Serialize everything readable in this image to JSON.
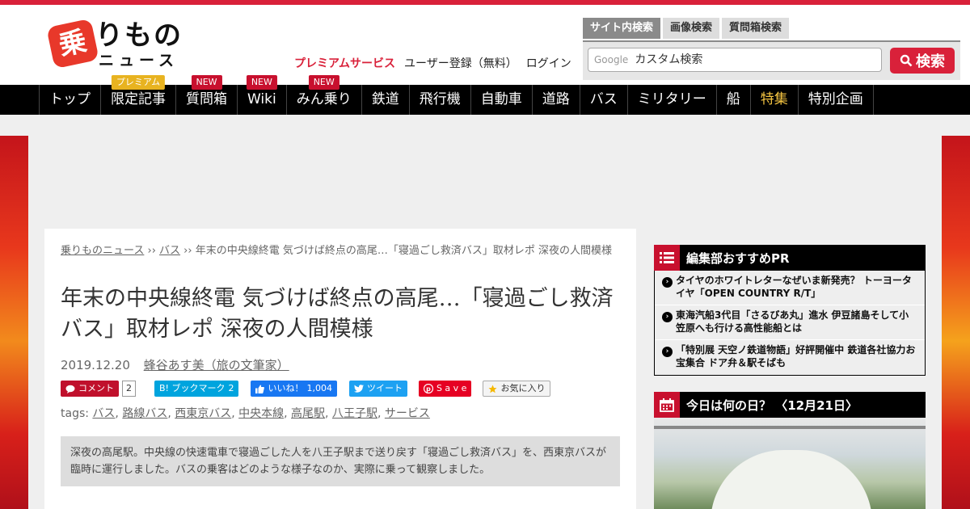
{
  "logo": {
    "mark": "乗",
    "text1": "りもの",
    "text2": "ニュース"
  },
  "header_links": {
    "premium": "プレミアムサービス",
    "register": "ユーザー登録（無料）",
    "login": "ログイン"
  },
  "search": {
    "tabs": [
      "サイト内検索",
      "画像検索",
      "質問箱検索"
    ],
    "google_label": "Google",
    "placeholder": "カスタム検索",
    "button": "検索"
  },
  "nav": [
    {
      "label": "トップ",
      "badge": ""
    },
    {
      "label": "限定記事",
      "badge": "プレミアム"
    },
    {
      "label": "質問箱",
      "badge": "NEW"
    },
    {
      "label": "Wiki",
      "badge": "NEW"
    },
    {
      "label": "みん乗り",
      "badge": "NEW"
    },
    {
      "label": "鉄道",
      "badge": ""
    },
    {
      "label": "飛行機",
      "badge": ""
    },
    {
      "label": "自動車",
      "badge": ""
    },
    {
      "label": "道路",
      "badge": ""
    },
    {
      "label": "バス",
      "badge": ""
    },
    {
      "label": "ミリタリー",
      "badge": ""
    },
    {
      "label": "船",
      "badge": ""
    },
    {
      "label": "特集",
      "badge": ""
    },
    {
      "label": "特別企画",
      "badge": ""
    }
  ],
  "breadcrumb": {
    "home": "乗りものニュース",
    "sep": " ›› ",
    "category": "バス",
    "current": "年末の中央線終電 気づけば終点の高尾…「寝過ごし救済バス」取材レポ 深夜の人間模様"
  },
  "article": {
    "title": "年末の中央線終電 気づけば終点の高尾…「寝過ごし救済バス」取材レポ 深夜の人間模様",
    "date": "2019.12.20",
    "author": "蜂谷あす美（旅の文筆家）",
    "lead": "深夜の高尾駅。中央線の快速電車で寝過ごした人を八王子駅まで送り戻す「寝過ごし救済バス」を、西東京バスが臨時に運行しました。バスの乗客はどのような様子なのか、実際に乗って観察しました。"
  },
  "share": {
    "comment": "コメント",
    "comment_count": "2",
    "hatena": "B! ブックマーク",
    "hatena_count": "2",
    "like": "いいね！",
    "like_count": "1,004",
    "tweet": "ツイート",
    "pin": "S a v e",
    "fav": "お気に入り"
  },
  "tags": {
    "label": "tags:",
    "items": [
      "バス",
      "路線バス",
      "西東京バス",
      "中央本線",
      "高尾駅",
      "八王子駅",
      "サービス"
    ]
  },
  "sidebar": {
    "pr_title": "編集部おすすめPR",
    "pr_items": [
      "タイヤのホワイトレターなぜいま新発売？ トーヨータイヤ「OPEN COUNTRY R/T」",
      "東海汽船3代目「さるびあ丸」進水 伊豆諸島そして小笠原へも行ける高性能船とは",
      "「特別展 天空ノ鉄道物語」好評開催中 鉄道各社協力お宝集合 ドア弁＆駅そばも"
    ],
    "today_title": "今日は何の日？ 〈12月21日〉"
  },
  "colors": {
    "brand_red": "#d9213a",
    "nav_bg": "#000000",
    "special": "#f5c542"
  }
}
